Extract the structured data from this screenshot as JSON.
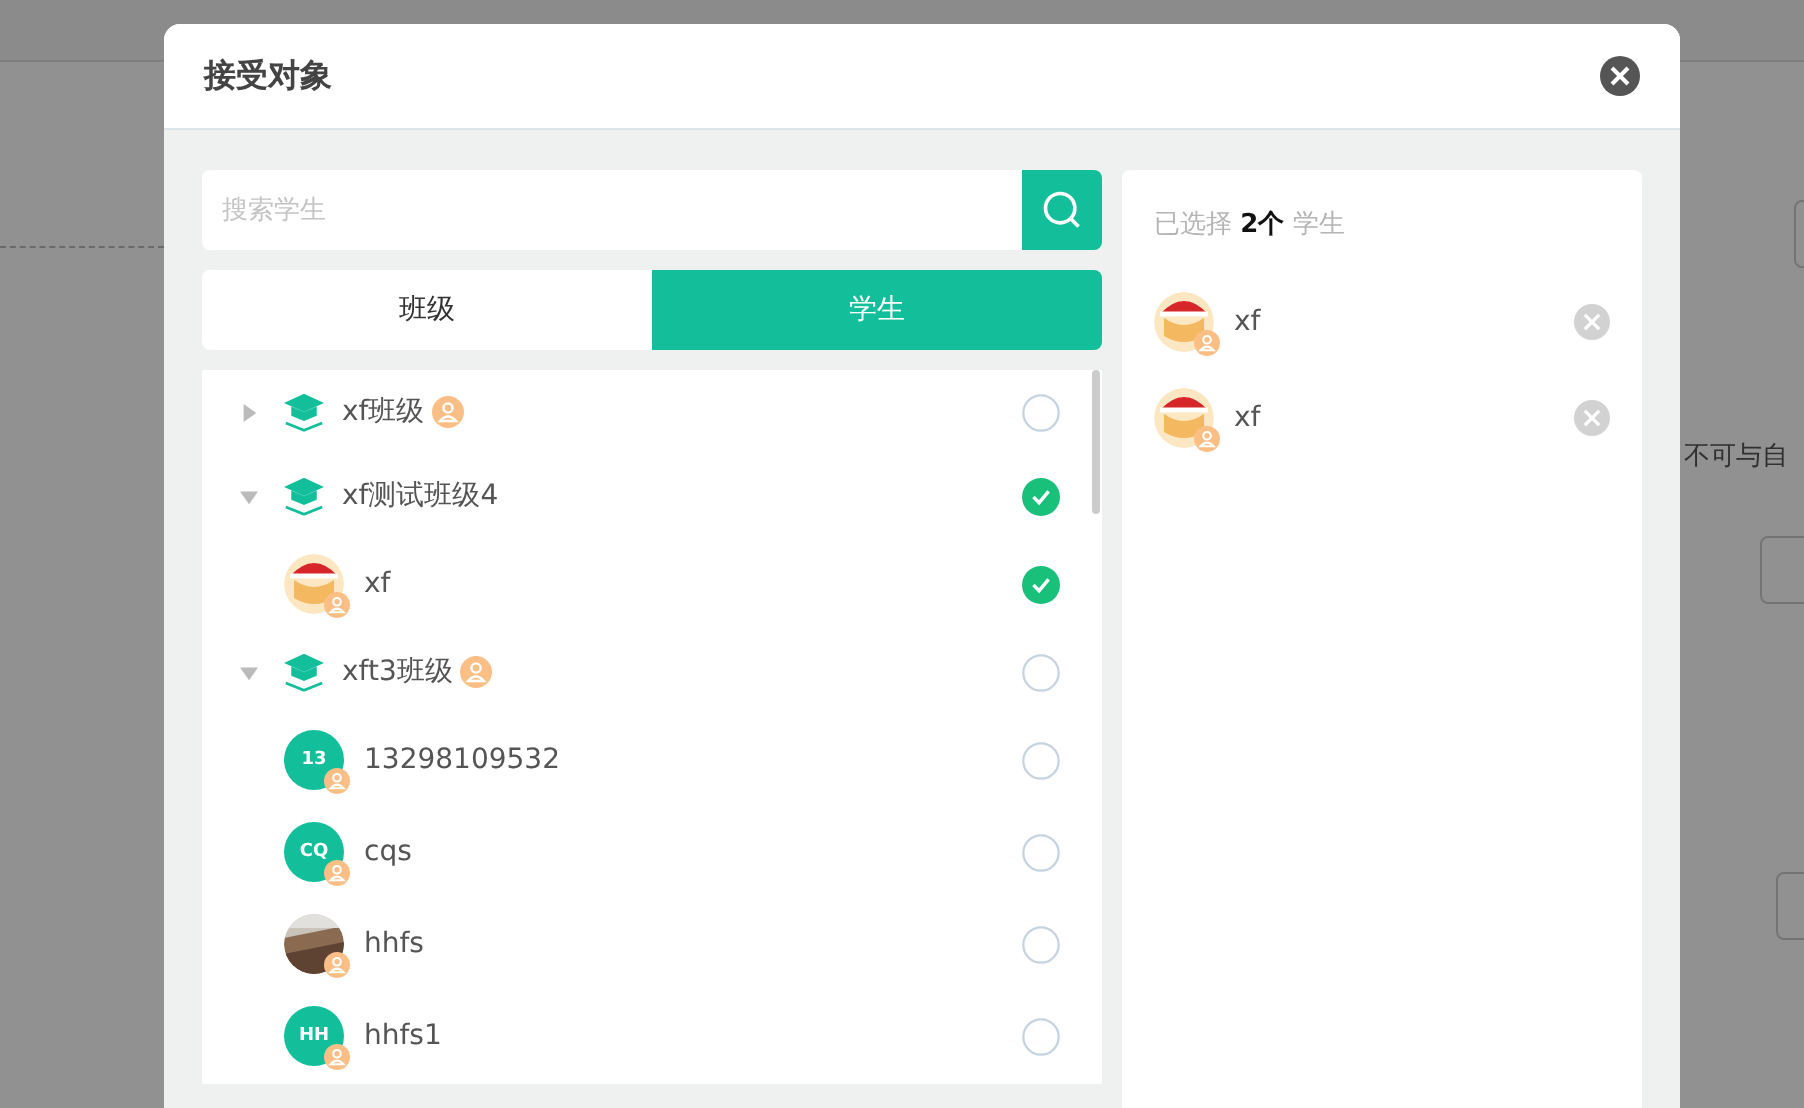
{
  "background": {
    "right_note": "不可与自"
  },
  "dialog": {
    "title": "接受对象",
    "search": {
      "placeholder": "搜索学生"
    },
    "tabs": [
      {
        "label": "班级",
        "selected": false
      },
      {
        "label": "学生",
        "selected": true
      }
    ],
    "tree": [
      {
        "label": "xf班级",
        "badge": true,
        "expanded": false,
        "checked": false
      },
      {
        "label": "xf测试班级4",
        "badge": false,
        "expanded": true,
        "checked": true,
        "children": [
          {
            "name": "xf",
            "avatar": {
              "kind": "cartoon"
            },
            "checked": true
          }
        ]
      },
      {
        "label": "xft3班级",
        "badge": true,
        "expanded": true,
        "checked": false,
        "children": [
          {
            "name": "13298109532",
            "avatar": {
              "kind": "initials",
              "text": "13"
            },
            "checked": false
          },
          {
            "name": "cqs",
            "avatar": {
              "kind": "initials",
              "text": "CQ"
            },
            "checked": false
          },
          {
            "name": "hhfs",
            "checked": false
          },
          {
            "name": "hhfs1",
            "avatar": {
              "kind": "initials",
              "text": "HH"
            },
            "checked": false
          }
        ]
      }
    ],
    "selected_summary": "已选择 **2个** 学生",
    "selected": [
      {
        "name": "xf",
        "avatar": {
          "kind": "cartoon"
        }
      },
      {
        "name": "xf",
        "avatar": {
          "kind": "cartoon"
        }
      }
    ]
  }
}
